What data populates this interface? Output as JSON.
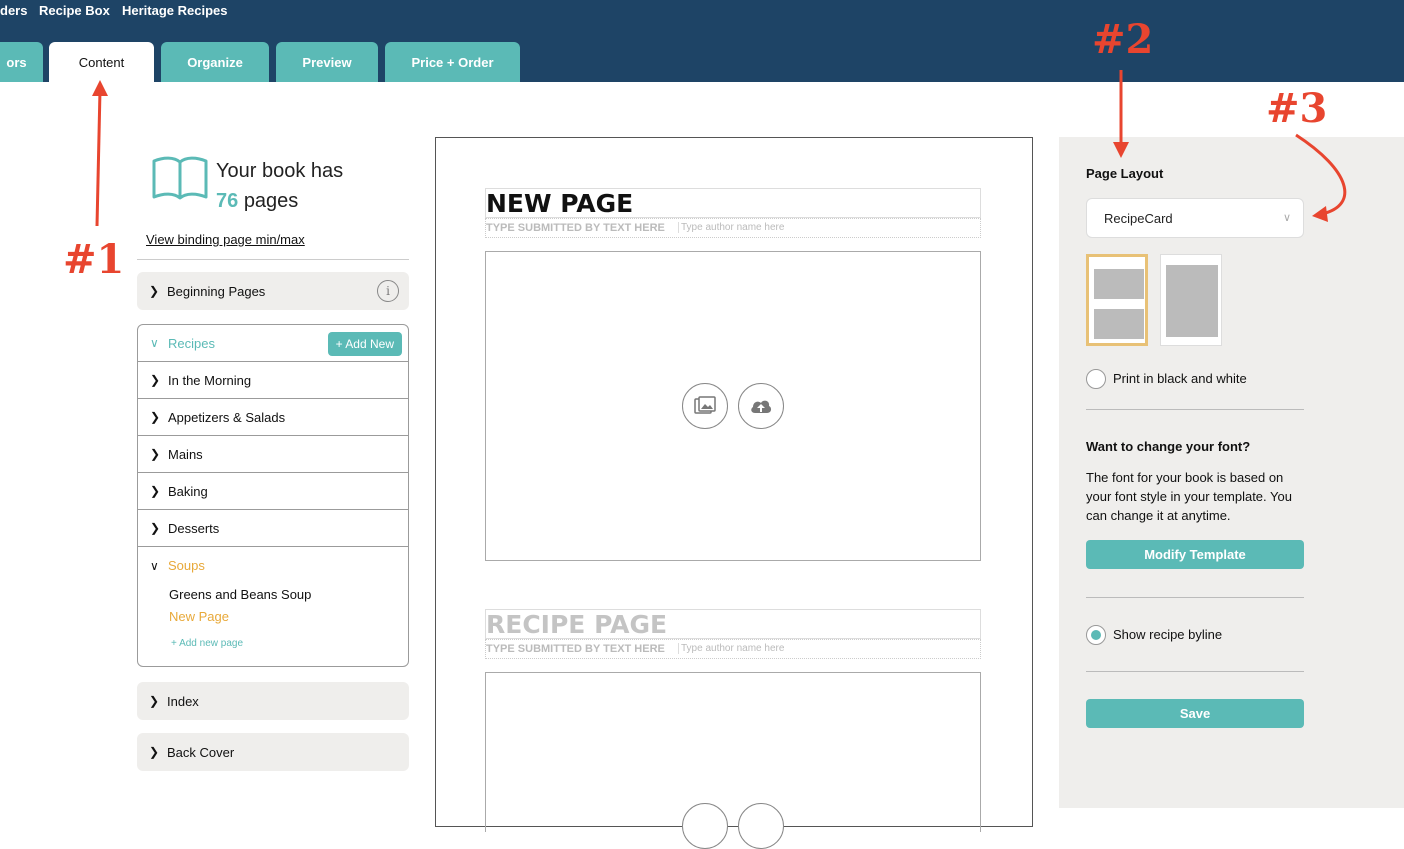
{
  "top_nav": [
    "ders",
    "Recipe Box",
    "Heritage Recipes"
  ],
  "tabs": [
    {
      "label": "ors",
      "active": false
    },
    {
      "label": "Content",
      "active": true
    },
    {
      "label": "Organize",
      "active": false
    },
    {
      "label": "Preview",
      "active": false
    },
    {
      "label": "Price + Order",
      "active": false
    }
  ],
  "left": {
    "book_line1": "Your book has",
    "page_count": "76",
    "book_line2": "pages",
    "binding_link": "View binding page min/max",
    "beginning_pages": "Beginning Pages",
    "recipes_label": "Recipes",
    "add_new": "+ Add New",
    "chapters": [
      "In the Morning",
      "Appetizers & Salads",
      "Mains",
      "Baking",
      "Desserts"
    ],
    "soups_label": "Soups",
    "soup_pages": [
      "Greens and Beans Soup",
      "New Page"
    ],
    "add_page": "+ Add new page",
    "index": "Index",
    "back_cover": "Back Cover"
  },
  "center": {
    "page1_title": "NEW PAGE",
    "page2_title": "RECIPE PAGE",
    "submitted_by": "TYPE SUBMITTED BY TEXT HERE",
    "author_placeholder": "Type author name here"
  },
  "right": {
    "layout_label": "Page Layout",
    "layout_value": "RecipeCard",
    "bw_label": "Print in black and white",
    "font_heading": "Want to change your font?",
    "font_text": "The font for your book is based on your font style in your template. You can change it at anytime.",
    "modify_btn": "Modify Template",
    "byline_label": "Show recipe byline",
    "save_btn": "Save"
  },
  "annotations": [
    "#1",
    "#2",
    "#3"
  ],
  "colors": {
    "header": "#1e4466",
    "teal": "#5bbab6",
    "gold": "#e8a93a",
    "annotation": "#e8452f"
  }
}
